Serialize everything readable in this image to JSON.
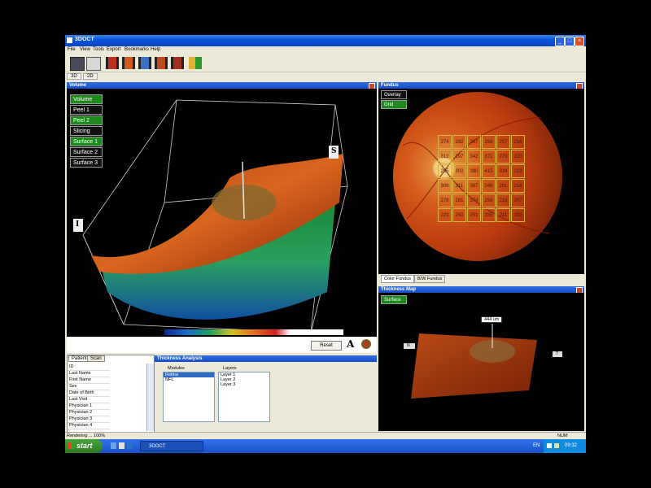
{
  "window": {
    "title": "3DOCT"
  },
  "menu": [
    "File",
    "View",
    "Tools",
    "Export",
    "Bookmarks",
    "Help"
  ],
  "tabs": [
    "3D",
    "2D"
  ],
  "toolbar_icons": [
    "save-icon",
    "print-icon",
    "film-icon-1",
    "film-icon-2",
    "film-icon-3",
    "film-icon-4",
    "film-icon-5",
    "export-icon"
  ],
  "volume": {
    "title": "Volume",
    "items": [
      {
        "label": "Volume",
        "on": true
      },
      {
        "label": "Peel 1",
        "on": false
      },
      {
        "label": "Peel 2",
        "on": true
      },
      {
        "label": "Slicing",
        "on": false
      },
      {
        "label": "Surface 1",
        "on": true
      },
      {
        "label": "Surface 2",
        "on": false
      },
      {
        "label": "Surface 3",
        "on": false
      }
    ],
    "axis_s": "S",
    "axis_i": "I",
    "reset_label": "Reset",
    "font_button": "A"
  },
  "fundus": {
    "title": "Fundus",
    "overlay_label": "Overlay",
    "grid_label": "Grid",
    "grid": [
      [
        "274",
        "292",
        "267",
        "256",
        "257",
        "216"
      ],
      [
        "312",
        "297",
        "342",
        "371",
        "273",
        "220"
      ],
      [
        "295",
        "302",
        "390",
        "415",
        "334",
        "219"
      ],
      [
        "309",
        "311",
        "367",
        "346",
        "281",
        "216"
      ],
      [
        "279",
        "281",
        "374",
        "256",
        "218",
        "207"
      ],
      [
        "223",
        "250",
        "251",
        "335",
        "211",
        "192"
      ]
    ],
    "tabs": [
      "Color Fundus",
      "B/W Fundus"
    ]
  },
  "thickness_map": {
    "title": "Thickness Map",
    "surface_label": "Surface",
    "callout": "444 um",
    "left_marker": "N",
    "right_marker": "T"
  },
  "patient": {
    "tabs": [
      "Patient",
      "Scan"
    ],
    "fields": [
      "ID",
      "Last Name",
      "First Name",
      "Sex",
      "Date of Birth",
      "Last Visit",
      "Physician 1",
      "Physician 2",
      "Physician 3",
      "Physician 4"
    ]
  },
  "thickness_analysis": {
    "title": "Thickness Analysis",
    "modules_label": "Modules",
    "modules": [
      "Retina",
      "NFL"
    ],
    "layers_label": "Layers",
    "layers": [
      "Layer 1",
      "Layer 2",
      "Layer 3"
    ]
  },
  "status": {
    "text": "Rendering ... 100%",
    "num": "NUM"
  },
  "taskbar": {
    "start": "start",
    "app": "3DOCT",
    "lang": "EN",
    "time": "09:32"
  },
  "colors": {
    "accent": "#1a4ec8",
    "active_green": "#1e8a1e",
    "fundus_orange": "#d9591c"
  }
}
